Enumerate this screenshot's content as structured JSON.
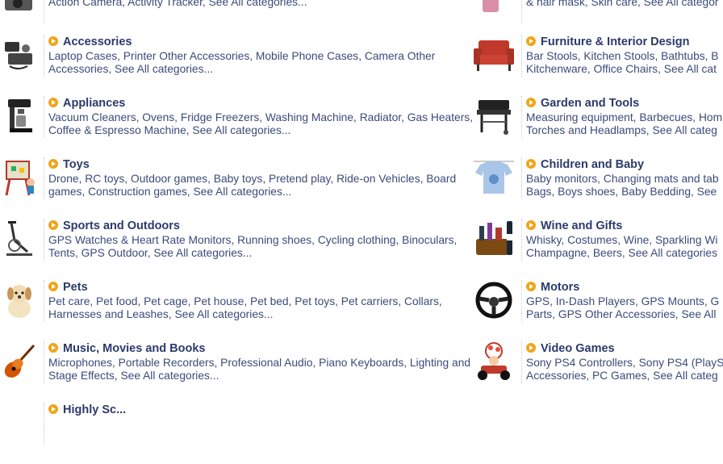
{
  "left": [
    {
      "title": "",
      "items": "Action Camera, Activity Tracker, See All categories...",
      "icon": "camera-icon"
    },
    {
      "title": "Accessories",
      "items": "Laptop Cases, Printer Other Accessories, Mobile Phone Cases, Camera Other Accessories, See All categories...",
      "icon": "accessories-icon"
    },
    {
      "title": "Appliances",
      "items": "Vacuum Cleaners, Ovens, Fridge Freezers, Washing Machine, Radiator, Gas Heaters, Coffee & Espresso Machine, See All categories...",
      "icon": "coffee-machine-icon"
    },
    {
      "title": "Toys",
      "items": "Drone, RC toys, Outdoor games, Baby toys, Pretend play, Ride-on Vehicles, Board games, Construction games, See All categories...",
      "icon": "easel-toy-icon"
    },
    {
      "title": "Sports and Outdoors",
      "items": "GPS Watches & Heart Rate Monitors, Running shoes, Cycling clothing, Binoculars, Tents, GPS Outdoor, See All categories...",
      "icon": "exercise-bike-icon"
    },
    {
      "title": "Pets",
      "items": "Pet care, Pet food, Pet cage, Pet house, Pet bed, Pet toys, Pet carriers, Collars, Harnesses and Leashes, See All categories...",
      "icon": "puppy-icon"
    },
    {
      "title": "Music, Movies and Books",
      "items": "Microphones, Portable Recorders, Professional Audio, Piano Keyboards, Lighting and Stage Effects, See All categories...",
      "icon": "guitar-icon"
    }
  ],
  "right": [
    {
      "title": "",
      "items": "& hair mask, Skin care, See All categor",
      "icon": "cosmetics-icon"
    },
    {
      "title": "Furniture & Interior Design",
      "items_line1": "Bar Stools, Kitchen Stools, Bathtubs, B",
      "items_line2": "Kitchenware, Office Chairs, See All cat",
      "icon": "armchair-icon"
    },
    {
      "title": "Garden and Tools",
      "items_line1": "Measuring equipment, Barbecues, Hom",
      "items_line2": "Torches and Headlamps, See All categ",
      "icon": "barbecue-icon"
    },
    {
      "title": "Children and Baby",
      "items_line1": "Baby monitors, Changing mats and tab",
      "items_line2": "Bags, Boys shoes, Baby Bedding, See",
      "icon": "baby-shirt-icon"
    },
    {
      "title": "Wine and Gifts",
      "items_line1": "Whisky, Costumes, Wine, Sparkling Wi",
      "items_line2": "Champagne, Beers, See All categories",
      "icon": "gift-basket-icon"
    },
    {
      "title": "Motors",
      "items_line1": "GPS, In-Dash Players, GPS Mounts, G",
      "items_line2": "Parts, GPS Other Accessories, See All",
      "icon": "steering-wheel-icon"
    },
    {
      "title": "Video Games",
      "items_line1": "Sony PS4 Controllers, Sony PS4 (PlayS",
      "items_line2": "Accessories, PC Games, See All categ",
      "icon": "kart-character-icon"
    }
  ],
  "partial_bottom": {
    "title": "Highly Sc..."
  },
  "colors": {
    "bullet": "#f0a418",
    "title": "#2b3a6b",
    "text": "#3b4b7a"
  }
}
